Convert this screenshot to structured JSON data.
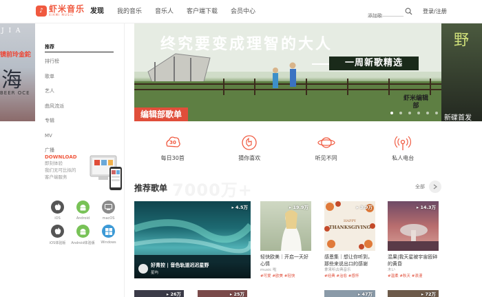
{
  "header": {
    "logo_cn": "虾米音乐",
    "logo_en": "XIAMI MUSIC",
    "nav": [
      "发现",
      "我的音乐",
      "音乐人",
      "客户端下载",
      "会员中心"
    ],
    "search_placeholder": "添加歌",
    "login": "登录/注册"
  },
  "sidebar": {
    "items": [
      "推荐",
      "排行榜",
      "歌单",
      "艺人",
      "曲风流派",
      "专辑",
      "MV",
      "广播"
    ],
    "download": {
      "title": "DOWNLOAD",
      "lines": [
        "即刻体验",
        "我们无可比拟的",
        "客户端服务"
      ]
    },
    "platforms": [
      "iOS",
      "Android",
      "macOS",
      "iOS体验版",
      "Android体验版",
      "Windows"
    ]
  },
  "banner": {
    "title": "终究要变成理智的大人",
    "subtitle": "一周新歌精选",
    "tag": "编辑部歌单",
    "stamp": "虾米编辑部",
    "left_top": "J I A",
    "left_mid": "镜前玲金鉈",
    "left_big": "海",
    "left_small": "BEER OCE",
    "right_text": "新碟首发",
    "right_big": "野"
  },
  "quick": [
    "每日30首",
    "猜你喜欢",
    "听见不同",
    "私人电台"
  ],
  "quick_icon_badge": "30",
  "section": {
    "title": "推荐歌单",
    "watermark": "7000万+",
    "all": "全部"
  },
  "cards": [
    {
      "plays": "4.5万",
      "title": "好青控 | 音色轨道迟迟星野",
      "author": "星屿",
      "tags": ""
    },
    {
      "plays": "19.9万",
      "title": "轻快欧美｜开启一天好心情",
      "author": "music 啦",
      "tags": "#可爱 #欧美 #轻快"
    },
    {
      "plays": "3.9万",
      "title": "感恩集｜想让你听到，那些来说出口的感谢",
      "author": "拿来听古典音乐",
      "tags": "#经典 #治愈 #感怀"
    },
    {
      "plays": "14.3万",
      "title": "混果|我天星被宇宙殴碎的黄昏",
      "author": "木い",
      "tags": "#温柔 #秋天 #浪漫"
    }
  ],
  "cover_text": {
    "thanksgiving": "THANKSGIVING",
    "happy": "HAPPY"
  },
  "bottom_plays": [
    "26万",
    "25万",
    "47万",
    "72万"
  ],
  "colors": {
    "accent": "#f0593f",
    "tag": "#e04e3a"
  }
}
